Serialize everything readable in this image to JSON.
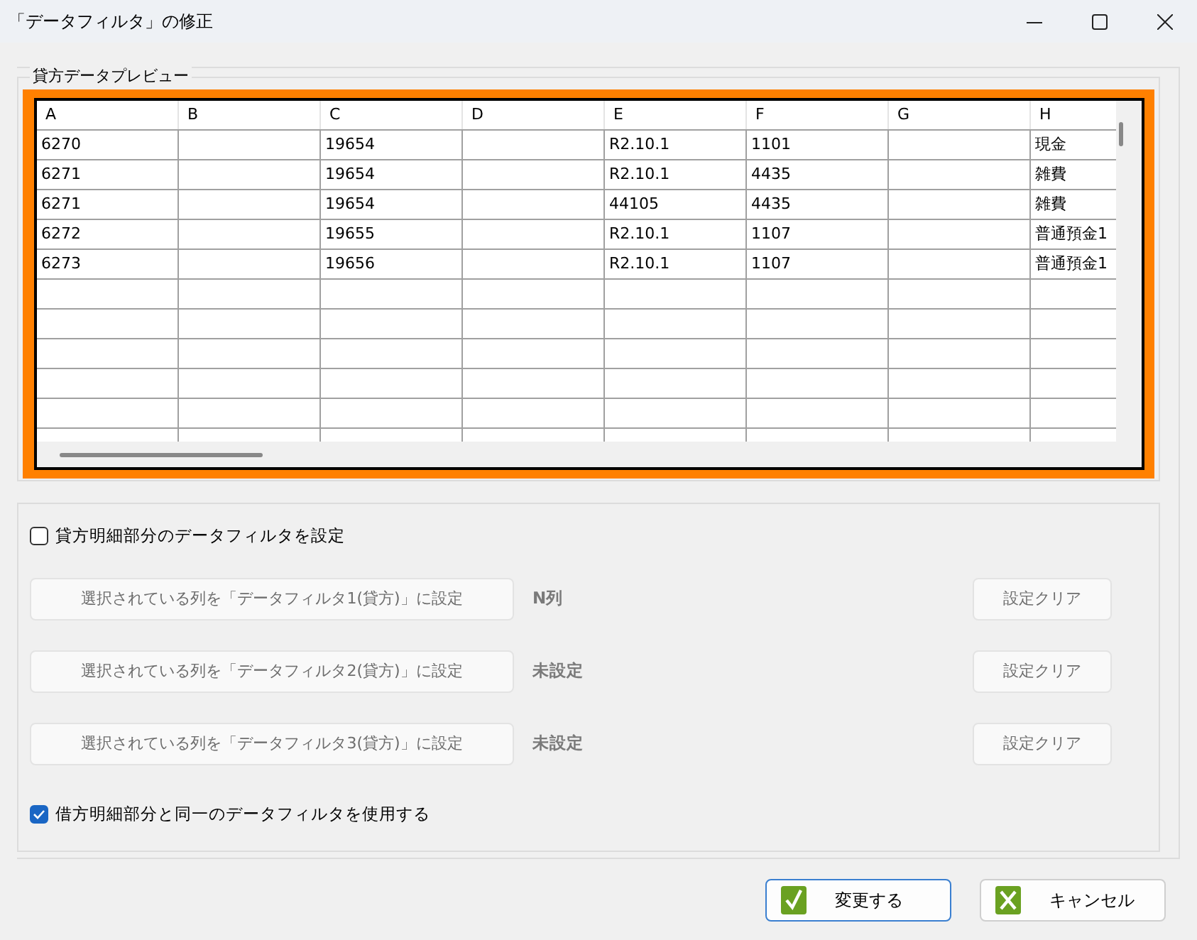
{
  "window": {
    "title": "「データフィルタ」の修正"
  },
  "preview": {
    "title": "貸方データプレビュー",
    "columns": [
      "A",
      "B",
      "C",
      "D",
      "E",
      "F",
      "G",
      "H"
    ],
    "rows": [
      {
        "A": "6270",
        "C": "19654",
        "E": "R2.10.1",
        "F": "1101",
        "H": "現金"
      },
      {
        "A": "6271",
        "C": "19654",
        "E": "R2.10.1",
        "F": "4435",
        "H": "雑費"
      },
      {
        "A": "6271",
        "C": "19654",
        "E": "44105",
        "F": "4435",
        "H": "雑費"
      },
      {
        "A": "6272",
        "C": "19655",
        "E": "R2.10.1",
        "F": "1107",
        "H": "普通預金1"
      },
      {
        "A": "6273",
        "C": "19656",
        "E": "R2.10.1",
        "F": "1107",
        "H": "普通預金1"
      }
    ]
  },
  "filter": {
    "enable": {
      "label": "貸方明細部分のデータフィルタを設定",
      "checked": false
    },
    "filters": [
      {
        "button": "選択されている列を「データフィルタ1(貸方)」に設定",
        "value": "N列",
        "clear": "設定クリア",
        "disabled": true
      },
      {
        "button": "選択されている列を「データフィルタ2(貸方)」に設定",
        "value": "未設定",
        "clear": "設定クリア",
        "disabled": true
      },
      {
        "button": "選択されている列を「データフィルタ3(貸方)」に設定",
        "value": "未設定",
        "clear": "設定クリア",
        "disabled": true
      }
    ],
    "same": {
      "label": "借方明細部分と同一のデータフィルタを使用する",
      "checked": true
    }
  },
  "buttons": [
    {
      "label": "変更する",
      "kind": "ok",
      "focused": true
    },
    {
      "label": "キャンセル",
      "kind": "cancel",
      "focused": false
    }
  ]
}
